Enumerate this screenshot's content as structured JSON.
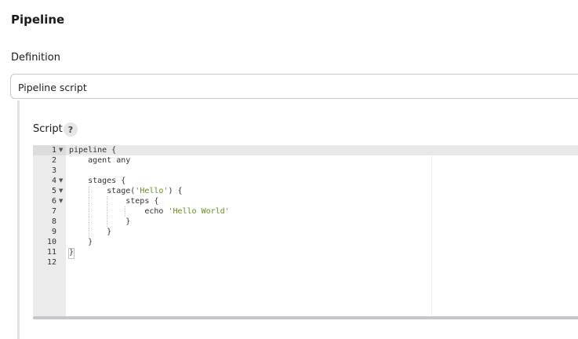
{
  "section": {
    "title": "Pipeline"
  },
  "definition": {
    "label": "Definition",
    "selected": "Pipeline script"
  },
  "script": {
    "label": "Script",
    "help": "?",
    "lines": [
      {
        "n": "1",
        "fold": true,
        "code": "pipeline {"
      },
      {
        "n": "2",
        "fold": false,
        "code": "    agent any"
      },
      {
        "n": "3",
        "fold": false,
        "code": ""
      },
      {
        "n": "4",
        "fold": true,
        "code": "    stages {"
      },
      {
        "n": "5",
        "fold": true,
        "code": "        stage('Hello') {"
      },
      {
        "n": "6",
        "fold": true,
        "code": "            steps {"
      },
      {
        "n": "7",
        "fold": false,
        "code": "                echo 'Hello World'"
      },
      {
        "n": "8",
        "fold": false,
        "code": "            }"
      },
      {
        "n": "9",
        "fold": false,
        "code": "        }"
      },
      {
        "n": "10",
        "fold": false,
        "code": "    }"
      },
      {
        "n": "11",
        "fold": false,
        "code": "}"
      },
      {
        "n": "12",
        "fold": false,
        "code": ""
      }
    ]
  },
  "icons": {
    "fold": "chevron-down-icon",
    "help": "question-icon"
  },
  "colors": {
    "string": "#6a8d1b",
    "gutter": "#ebebeb",
    "accent_bar": "#dfe3e6"
  }
}
